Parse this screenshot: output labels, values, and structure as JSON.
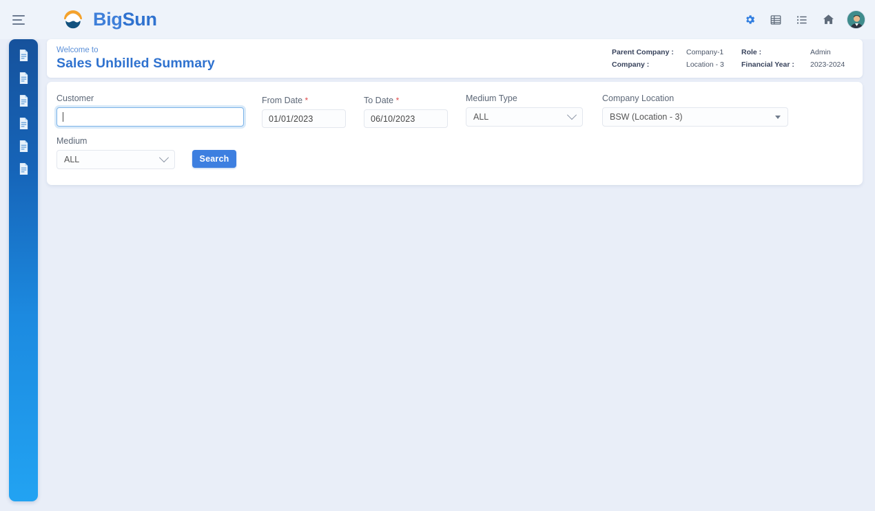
{
  "brand": {
    "name_part1": "Big",
    "name_part2": "Sun",
    "logo_icon": "sun-wave-logo-icon"
  },
  "topbar": {
    "menu_toggle": "hamburger-menu-icon",
    "icons": [
      {
        "name": "settings-gear-icon",
        "glyph": "gear"
      },
      {
        "name": "grid-table-icon",
        "glyph": "grid"
      },
      {
        "name": "list-icon",
        "glyph": "list"
      },
      {
        "name": "home-icon",
        "glyph": "home"
      }
    ],
    "avatar_alt": "user-avatar"
  },
  "sidebar": {
    "items": [
      {
        "name": "sidebar-item-document-1",
        "icon": "document-icon"
      },
      {
        "name": "sidebar-item-document-2",
        "icon": "document-icon"
      },
      {
        "name": "sidebar-item-document-3",
        "icon": "document-icon"
      },
      {
        "name": "sidebar-item-document-4",
        "icon": "document-icon"
      },
      {
        "name": "sidebar-item-document-5",
        "icon": "document-icon"
      },
      {
        "name": "sidebar-item-document-6",
        "icon": "document-icon"
      }
    ]
  },
  "banner": {
    "welcome_text": "Welcome to",
    "page_title": "Sales Unbilled Summary",
    "meta": {
      "parent_company_label": "Parent Company :",
      "parent_company_value": "Company-1",
      "company_label": "Company :",
      "company_value": "Location - 3",
      "role_label": "Role :",
      "role_value": "Admin",
      "financial_year_label": "Financial Year :",
      "financial_year_value": "2023-2024"
    }
  },
  "form": {
    "customer_label": "Customer",
    "customer_value": "",
    "customer_placeholder": "",
    "from_date_label": "From Date",
    "from_date_value": "01/01/2023",
    "to_date_label": "To Date",
    "to_date_value": "06/10/2023",
    "medium_type_label": "Medium Type",
    "medium_type_value": "ALL",
    "company_location_label": "Company Location",
    "company_location_value": "BSW (Location - 3)",
    "medium_label": "Medium",
    "medium_value": "ALL",
    "required_marker": "*",
    "search_label": "Search"
  },
  "colors": {
    "accent_blue": "#3d7fe0",
    "brand_blue": "#2f72cf",
    "page_background": "#e9eef8",
    "required_red": "#e04a4a",
    "sidebar_gradient_start": "#16529c",
    "sidebar_gradient_end": "#22a3f2"
  }
}
